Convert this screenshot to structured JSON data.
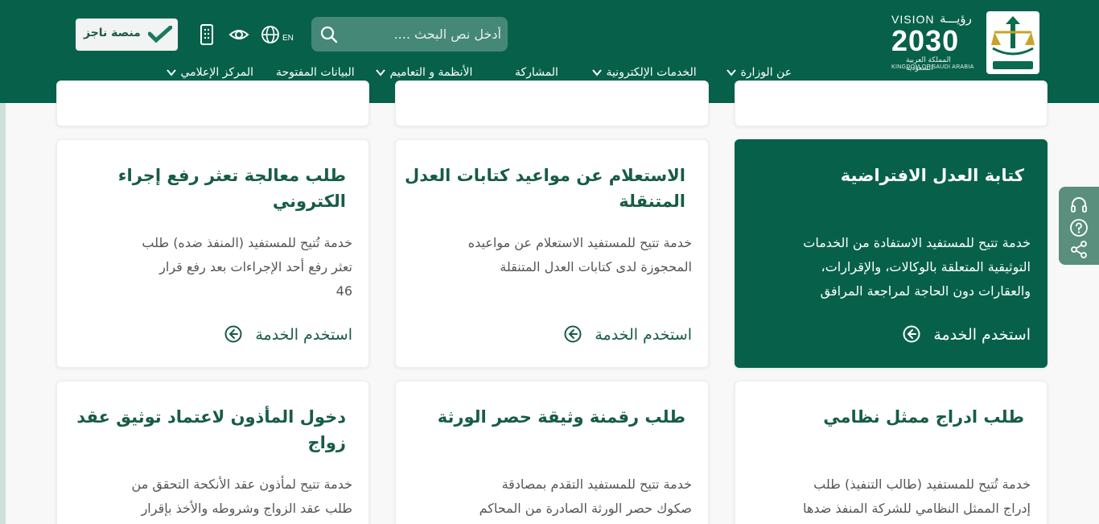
{
  "header": {
    "vision": {
      "top_en": "VISION",
      "top_ar": "رؤيـــة",
      "year": "2030",
      "sub_ar": "المملكة العربية السعودية",
      "sub_en": "KINGDOM OF SAUDI ARABIA"
    },
    "emblem_icon": "ministry-emblem-icon",
    "search": {
      "placeholder": "أدخل نص البحث ....",
      "value": ""
    },
    "lang_label": "EN",
    "najiz_label": "منصة ناجز",
    "nav": [
      {
        "label": "عن الوزارة",
        "has_dropdown": true
      },
      {
        "label": "الخدمات الإلكترونية",
        "has_dropdown": true
      },
      {
        "label": "المشاركة",
        "has_dropdown": false
      },
      {
        "label": "الأنظمة و التعاميم",
        "has_dropdown": true
      },
      {
        "label": "البيانات المفتوحة",
        "has_dropdown": false
      },
      {
        "label": "المركز الإعلامي",
        "has_dropdown": true
      }
    ]
  },
  "cards": [
    {
      "title": "كتابة العدل الافتراضية",
      "desc_lines": [
        "خدمة تتيح للمستفيد الاستفادة من الخدمات",
        "التوثيقية المتعلقة بالوكالات، والإقرارات،",
        "والعقارات دون الحاجة لمراجعة المرافق"
      ],
      "cta": "استخدم الخدمة",
      "featured": true
    },
    {
      "title": "الاستعلام عن مواعيد كتابات العدل المتنقلة",
      "title_lines": [
        "الاستعلام عن مواعيد كتابات العدل",
        "المتنقلة"
      ],
      "desc_lines": [
        "خدمة تتيح للمستفيد الاستعلام عن مواعيده",
        "المحجوزة لدى كتابات العدل المتنقلة"
      ],
      "cta": "استخدم الخدمة",
      "featured": false
    },
    {
      "title_lines": [
        "طلب معالجة تعثر رفع إجراء",
        "الكتروني"
      ],
      "desc_lines": [
        "خدمة تُتيح للمستفيد (المنفذ ضده) طلب",
        "تعثر رفع أحد الإجراءات بعد رفع قرار",
        "46"
      ],
      "cta": "استخدم الخدمة",
      "featured": false
    },
    {
      "title_lines": [
        "طلب ادراج ممثل نظامي"
      ],
      "desc_lines": [
        "خدمة تُتيح للمستفيد (طالب التنفيذ) طلب",
        "إدراج الممثل النظامي للشركة المنفذ ضدها"
      ]
    },
    {
      "title_lines": [
        "طلب رقمنة وثيقة حصر الورثة"
      ],
      "desc_lines": [
        "خدمة تتيح للمستفيد التقدم بمصادقة",
        "صكوك حصر الورثة الصادرة من المحاكم"
      ]
    },
    {
      "title_lines": [
        "دخول المأذون لاعتماد توثيق عقد",
        "زواج"
      ],
      "desc_lines": [
        "خدمة تتيح لمأذون عقد الأنكحة التحقق من",
        "طلب عقد الزواج وشروطه والأخذ بإقرار"
      ]
    }
  ],
  "side_panel": {
    "icons": [
      "headset-icon",
      "help-icon",
      "share-icon"
    ]
  },
  "colors": {
    "brand": "#07614a",
    "brand_text": "#175c45",
    "side_panel": "#5a8f7d"
  }
}
